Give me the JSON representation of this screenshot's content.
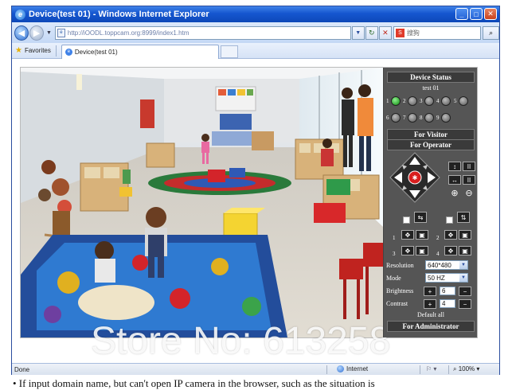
{
  "window": {
    "title": "Device(test 01) - Windows Internet Explorer"
  },
  "address_bar": {
    "url": "http://iOODL.toppcam.org:8999/index1.htm",
    "search_placeholder": "搜狗"
  },
  "favorites": {
    "label": "Favorites",
    "tab_label": "Device(test 01)"
  },
  "panel": {
    "device_status": "Device Status",
    "device_name": "test 01",
    "leds": [
      {
        "num": "1",
        "on": true
      },
      {
        "num": "2",
        "on": false
      },
      {
        "num": "3",
        "on": false
      },
      {
        "num": "4",
        "on": false
      },
      {
        "num": "5",
        "on": false
      },
      {
        "num": "6",
        "on": false
      },
      {
        "num": "7",
        "on": false
      },
      {
        "num": "8",
        "on": false
      },
      {
        "num": "9",
        "on": false
      }
    ],
    "for_visitor": "For Visitor",
    "for_operator": "For Operator",
    "preset_1": "1",
    "preset_2": "2",
    "preset_3": "3",
    "preset_4": "4",
    "resolution_label": "Resolution",
    "resolution_value": "640*480",
    "mode_label": "Mode",
    "mode_value": "50 HZ",
    "brightness_label": "Brightness",
    "brightness_value": "6",
    "contrast_label": "Contrast",
    "contrast_value": "4",
    "default_all": "Default all",
    "for_administrator": "For Administrator"
  },
  "status_bar": {
    "left": "Done",
    "zone": "Internet",
    "zoom": "100%"
  },
  "watermark": "Store No: 613258",
  "page_text": "• If input domain name, but can't open IP camera in the browser, such as the situation is"
}
